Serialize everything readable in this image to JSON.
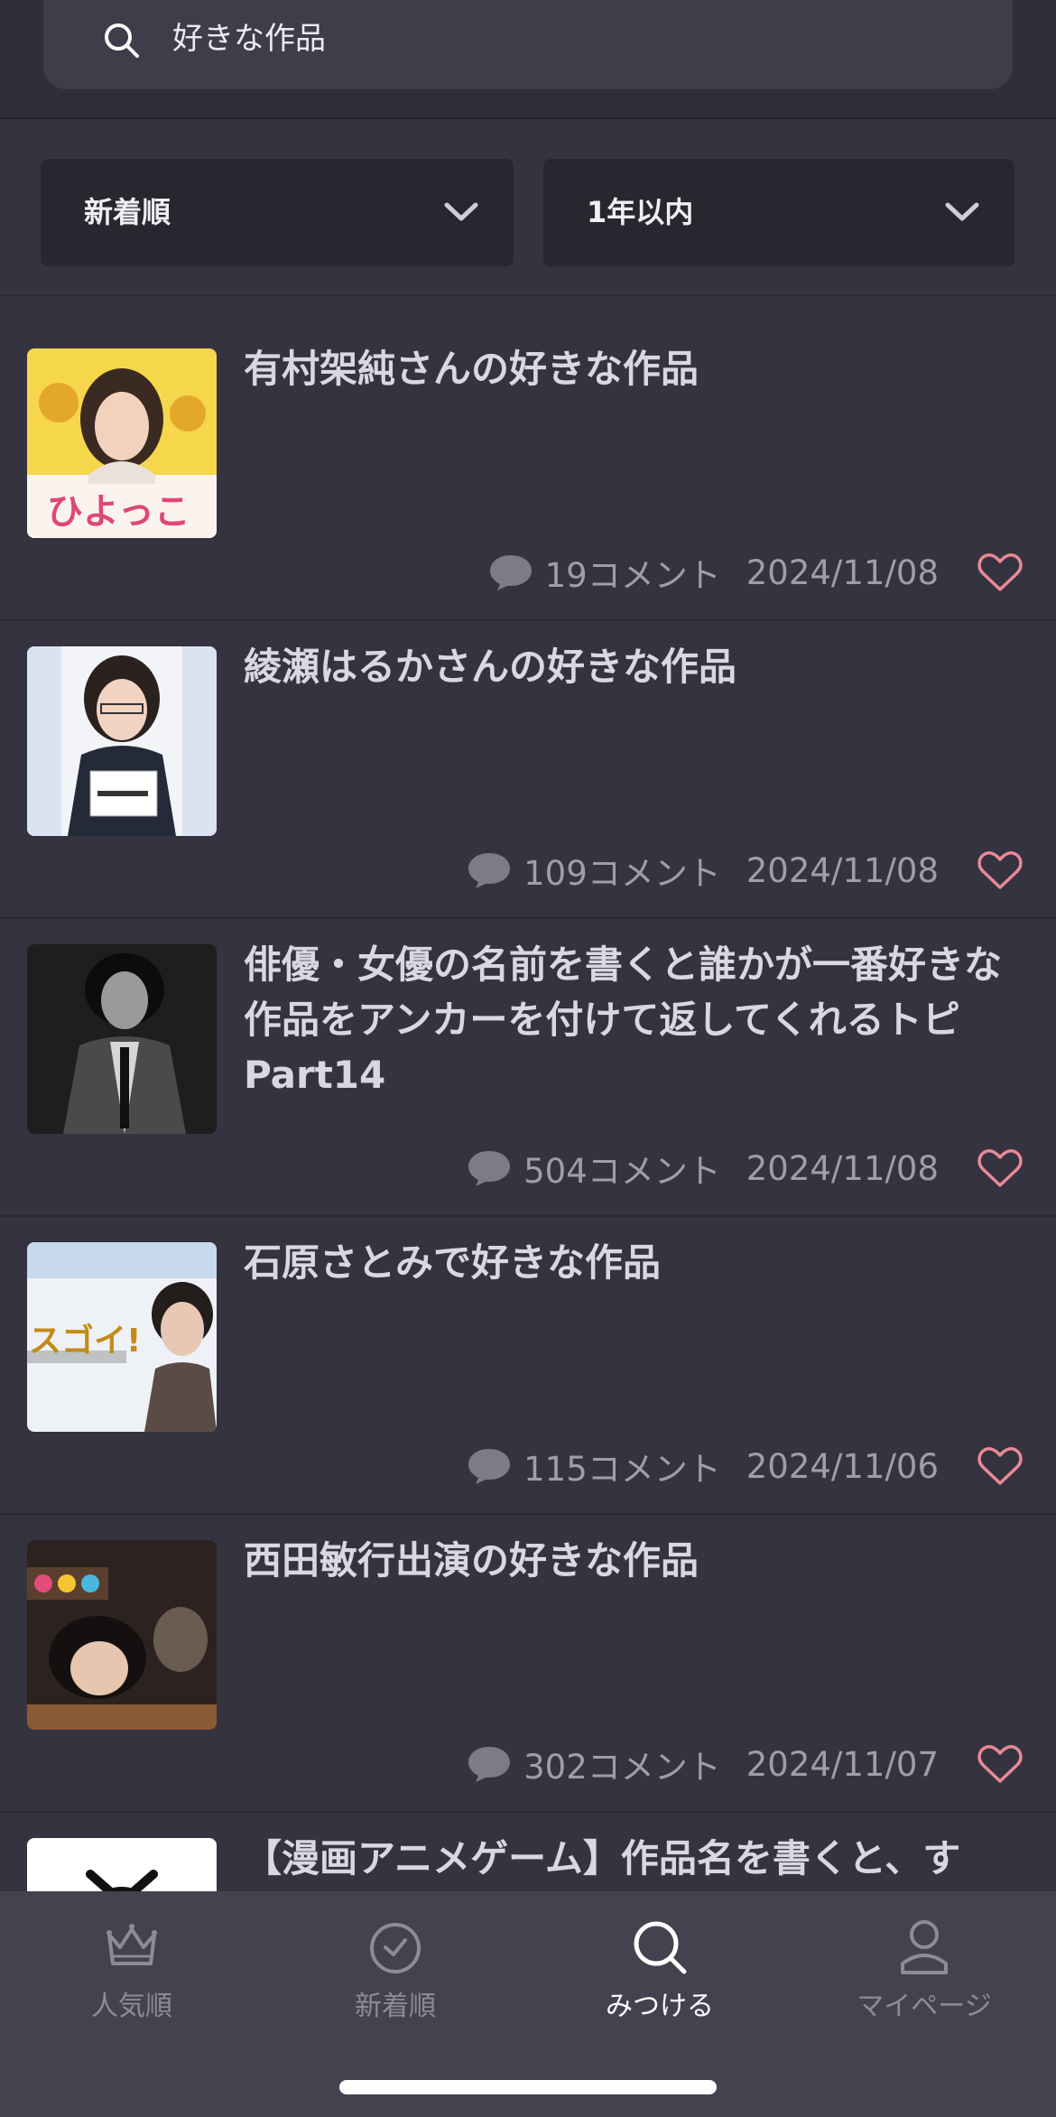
{
  "search": {
    "query": "好きな作品",
    "icon": "search-icon"
  },
  "filters": {
    "sort": {
      "label": "新着順",
      "icon": "chevron-down-icon"
    },
    "period": {
      "label": "1年以内",
      "icon": "chevron-down-icon"
    }
  },
  "items": [
    {
      "title": "有村架純さんの好きな作品",
      "comments": "19コメント",
      "date": "2024/11/08",
      "thumb_desc": "ひよっこ"
    },
    {
      "title": "綾瀬はるかさんの好きな作品",
      "comments": "109コメント",
      "date": "2024/11/08"
    },
    {
      "title": "俳優・女優の名前を書くと誰かが一番好きな作品をアンカーを付けて返してくれるトピ Part14",
      "comments": "504コメント",
      "date": "2024/11/08"
    },
    {
      "title": "石原さとみで好きな作品",
      "comments": "115コメント",
      "date": "2024/11/06",
      "thumb_desc": "スゴイ!"
    },
    {
      "title": "西田敏行出演の好きな作品",
      "comments": "302コメント",
      "date": "2024/11/07"
    },
    {
      "title": "【漫画アニメゲーム】作品名を書くと、す"
    }
  ],
  "nav": [
    {
      "label": "人気順",
      "icon": "crown-icon",
      "active": false
    },
    {
      "label": "新着順",
      "icon": "clock-icon",
      "active": false
    },
    {
      "label": "みつける",
      "icon": "search-icon",
      "active": true
    },
    {
      "label": "マイページ",
      "icon": "user-icon",
      "active": false
    }
  ],
  "colors": {
    "background": "#35333f",
    "heart": "#e88a96",
    "nav_background": "#44424f"
  }
}
